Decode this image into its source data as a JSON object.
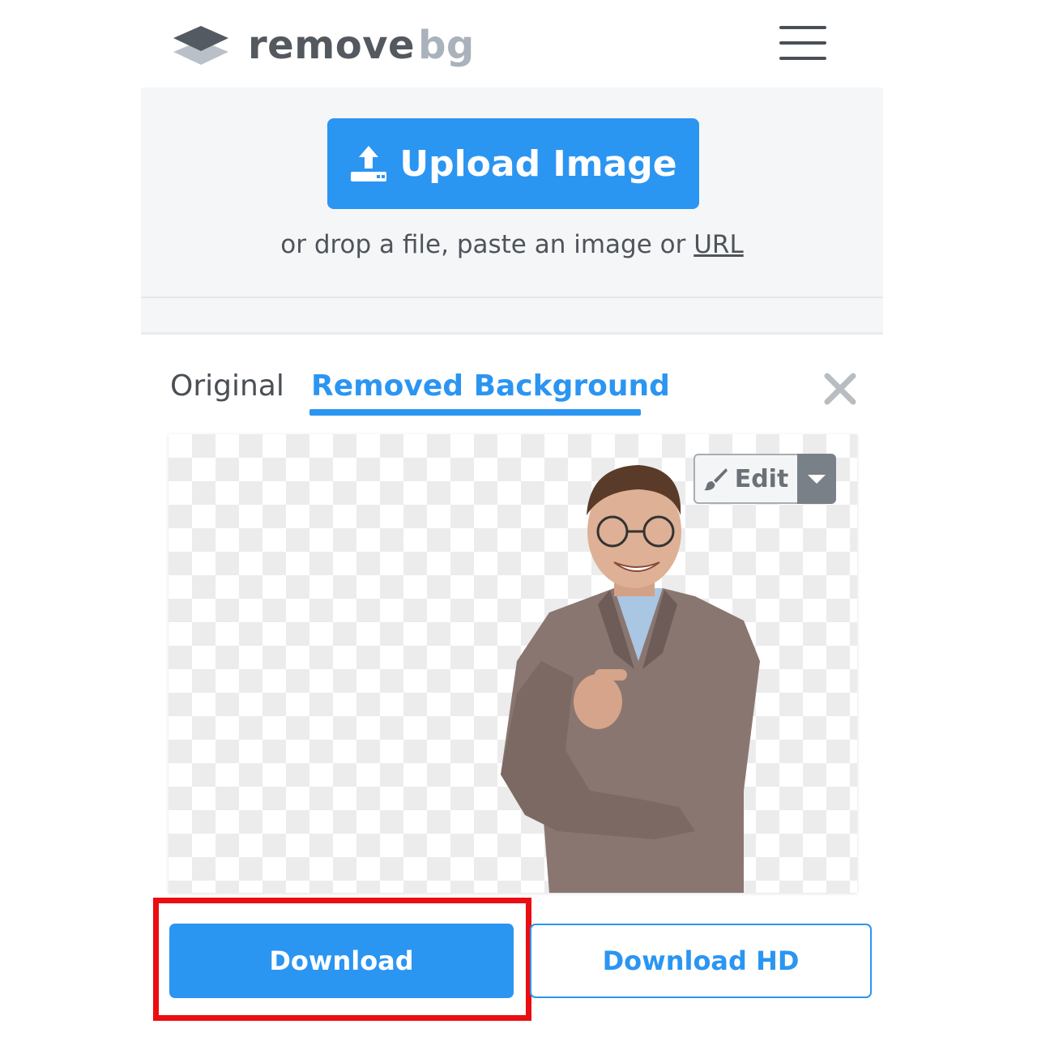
{
  "header": {
    "logo_icon": "layers-icon",
    "logo_word_1": "remove",
    "logo_word_2": "bg",
    "menu_icon": "hamburger-menu-icon"
  },
  "upload": {
    "button_label": "Upload Image",
    "button_icon": "upload-icon",
    "hint_prefix": "or drop a file, paste an image or ",
    "hint_link": "URL"
  },
  "tabs": [
    {
      "label": "Original",
      "active": false
    },
    {
      "label": "Removed Background",
      "active": true
    }
  ],
  "result": {
    "close_icon": "close-icon",
    "preview_image": "person-cutout-image",
    "edit_label": "Edit",
    "edit_icon": "brush-icon",
    "edit_dropdown_icon": "caret-down-icon"
  },
  "actions": {
    "download_label": "Download",
    "download_hd_label": "Download HD",
    "highlighted": "Download"
  },
  "colors": {
    "accent": "#2b95f2",
    "highlight": "#ea0d12",
    "logo_dark": "#54595f",
    "logo_light": "#aab2bb"
  }
}
